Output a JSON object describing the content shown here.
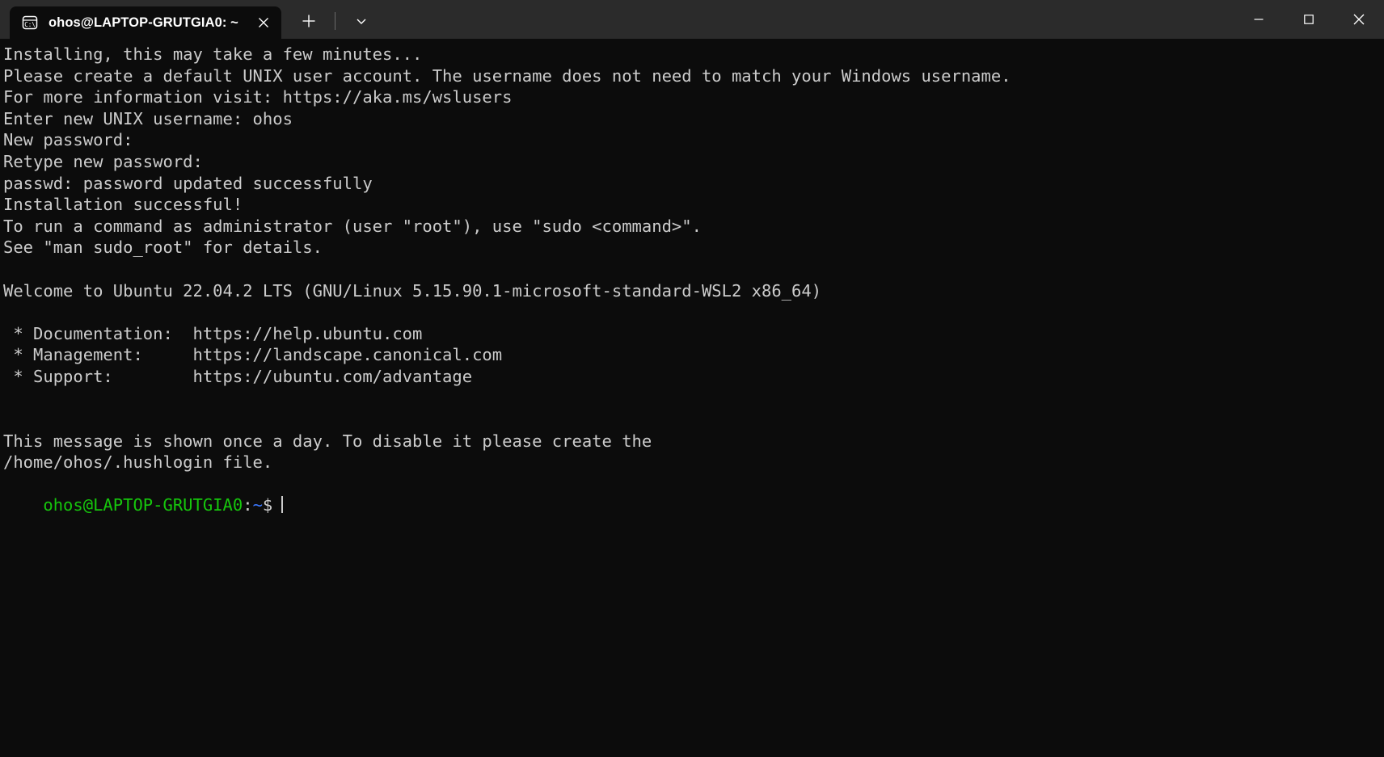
{
  "window": {
    "app": "Windows Terminal",
    "titlebar_bg": "#2b2b2b",
    "terminal_bg": "#0c0c0c"
  },
  "tab": {
    "title": "ohos@LAPTOP-GRUTGIA0: ~",
    "icon": "console-cmd-icon",
    "icon_text": "C:\\",
    "close_icon": "close-icon",
    "new_tab_icon": "plus-icon",
    "dropdown_icon": "chevron-down-icon"
  },
  "window_controls": {
    "minimize": "minimize-icon",
    "maximize": "maximize-icon",
    "close": "close-icon"
  },
  "terminal": {
    "colors": {
      "foreground": "#cccccc",
      "prompt_user_host": "#16c60c",
      "prompt_path": "#3b78ff",
      "background": "#0c0c0c"
    },
    "lines": [
      "Installing, this may take a few minutes...",
      "Please create a default UNIX user account. The username does not need to match your Windows username.",
      "For more information visit: https://aka.ms/wslusers",
      "Enter new UNIX username: ohos",
      "New password:",
      "Retype new password:",
      "passwd: password updated successfully",
      "Installation successful!",
      "To run a command as administrator (user \"root\"), use \"sudo <command>\".",
      "See \"man sudo_root\" for details.",
      "",
      "Welcome to Ubuntu 22.04.2 LTS (GNU/Linux 5.15.90.1-microsoft-standard-WSL2 x86_64)",
      "",
      " * Documentation:  https://help.ubuntu.com",
      " * Management:     https://landscape.canonical.com",
      " * Support:        https://ubuntu.com/advantage",
      "",
      "",
      "This message is shown once a day. To disable it please create the",
      "/home/ohos/.hushlogin file."
    ],
    "prompt": {
      "user_host": "ohos@LAPTOP-GRUTGIA0",
      "separator": ":",
      "path": "~",
      "symbol": "$"
    }
  }
}
